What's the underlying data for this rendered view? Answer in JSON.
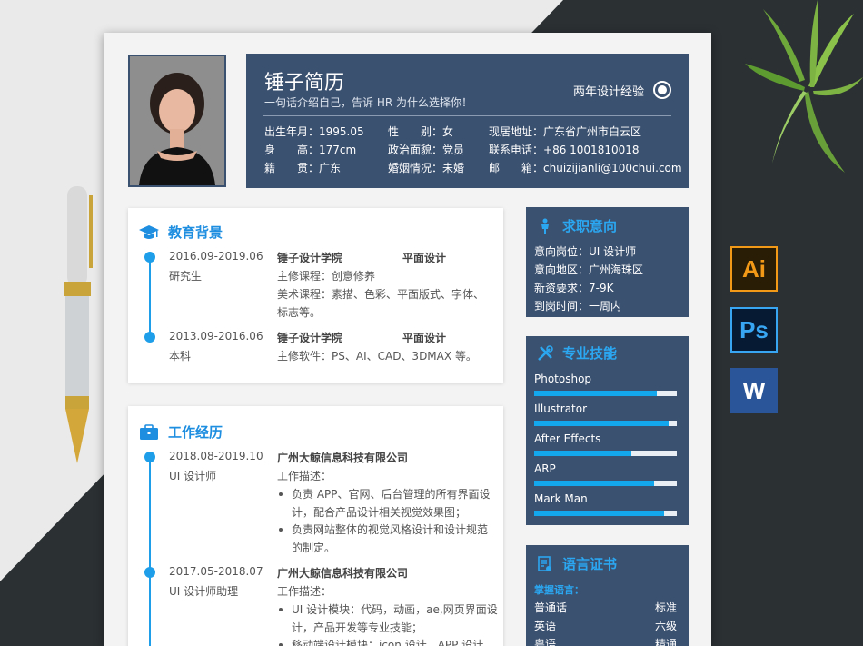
{
  "resume": {
    "name": "锤子简历",
    "tagline": "一句话介绍自己，告诉 HR 为什么选择你！",
    "experience_years": "两年设计经验",
    "info": [
      {
        "label": "出生年月：",
        "value": "1995.05"
      },
      {
        "label": "性　　别：",
        "value": "女"
      },
      {
        "label": "现居地址：",
        "value": "广东省广州市白云区"
      },
      {
        "label": "身　　高：",
        "value": "177cm"
      },
      {
        "label": "政治面貌：",
        "value": "党员"
      },
      {
        "label": "联系电话：",
        "value": "+86 1001810018"
      },
      {
        "label": "籍　　贯：",
        "value": "广东"
      },
      {
        "label": "婚姻情况：",
        "value": "未婚"
      },
      {
        "label": "邮　　箱：",
        "value": "chuizijianli@100chui.com"
      }
    ]
  },
  "education": {
    "title": "教育背景",
    "items": [
      {
        "period": "2016.09-2019.06",
        "degree": "研究生",
        "school": "锤子设计学院",
        "major": "平面设计",
        "lines": [
          "主修课程：创意修养",
          "美术课程：素描、色彩、平面版式、字体、",
          "标志等。"
        ]
      },
      {
        "period": "2013.09-2016.06",
        "degree": "本科",
        "school": "锤子设计学院",
        "major": "平面设计",
        "lines": [
          "主修软件：PS、AI、CAD、3DMAX 等。"
        ]
      }
    ]
  },
  "work": {
    "title": "工作经历",
    "items": [
      {
        "period": "2018.08-2019.10",
        "role": "UI 设计师",
        "company": "广州大鲸信息科技有限公司",
        "desc_label": "工作描述：",
        "bullets": [
          [
            "负责 APP、官网、后台管理的所有界面设",
            "计，配合产品设计相关视觉效果图；"
          ],
          [
            "负责网站整体的视觉风格设计和设计规范",
            "的制定。"
          ]
        ]
      },
      {
        "period": "2017.05-2018.07",
        "role": "UI 设计师助理",
        "company": "广州大鲸信息科技有限公司",
        "desc_label": "工作描述：",
        "bullets": [
          [
            "UI 设计模块：代码，动画，ae,网页界面设",
            "计，产品开发等专业技能；"
          ],
          [
            "移动端设计模块：icon 设计，APP 设计"
          ]
        ]
      }
    ]
  },
  "job_intention": {
    "title": "求职意向",
    "items": [
      {
        "label": "意向岗位：",
        "value": "UI 设计师"
      },
      {
        "label": "意向地区：",
        "value": "广州海珠区"
      },
      {
        "label": "新资要求：",
        "value": "7-9K"
      },
      {
        "label": "到岗时间：",
        "value": "一周内"
      }
    ]
  },
  "skills": {
    "title": "专业技能",
    "items": [
      {
        "name": "Photoshop",
        "level": 0.86
      },
      {
        "name": "Illustrator",
        "level": 0.94
      },
      {
        "name": "After Effects",
        "level": 0.68
      },
      {
        "name": "ARP",
        "level": 0.84
      },
      {
        "name": "Mark Man",
        "level": 0.91
      }
    ]
  },
  "languages": {
    "title": "语言证书",
    "subtitle": "掌握语言：",
    "items": [
      {
        "name": "普通话",
        "level": "标准"
      },
      {
        "name": "英语",
        "level": "六级"
      },
      {
        "name": "粤语",
        "level": "精通"
      }
    ]
  },
  "app_icons": [
    {
      "name": "ai-icon",
      "label": "Ai",
      "color": "#f29a17"
    },
    {
      "name": "ps-icon",
      "label": "Ps",
      "color": "#38a6f2"
    },
    {
      "name": "word-icon",
      "label": "W",
      "color": "#2a5699"
    }
  ],
  "colors": {
    "primary": "#3b5170",
    "accent": "#1e9ee8",
    "background_dark": "#2b3033"
  }
}
